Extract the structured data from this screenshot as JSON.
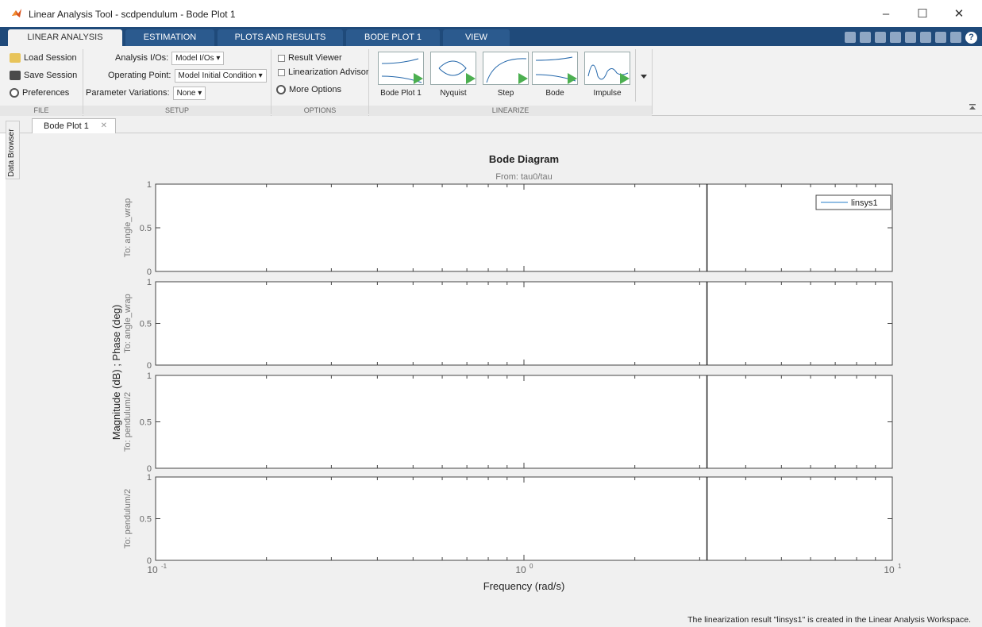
{
  "window": {
    "title": "Linear Analysis Tool - scdpendulum - Bode Plot 1",
    "minimize": "–",
    "maximize": "☐",
    "close": "✕"
  },
  "ribbon": {
    "tabs": [
      "LINEAR ANALYSIS",
      "ESTIMATION",
      "PLOTS AND RESULTS",
      "BODE PLOT 1",
      "VIEW"
    ],
    "help_glyph": "?"
  },
  "toolstrip": {
    "file": {
      "load": "Load Session",
      "save": "Save Session",
      "prefs": "Preferences",
      "label": "FILE"
    },
    "setup": {
      "analysis_ios_label": "Analysis I/Os:",
      "analysis_ios_value": "Model I/Os ▾",
      "operating_point_label": "Operating Point:",
      "operating_point_value": "Model Initial Condition ▾",
      "param_var_label": "Parameter Variations:",
      "param_var_value": "None ▾",
      "label": "SETUP"
    },
    "options": {
      "result_viewer": "Result Viewer",
      "lin_advisor": "Linearization Advisor",
      "more_options": "More Options",
      "label": "OPTIONS"
    },
    "linearize": {
      "buttons": [
        "Bode Plot 1",
        "Nyquist",
        "Step",
        "Bode",
        "Impulse"
      ],
      "label": "LINEARIZE"
    }
  },
  "documents": {
    "tab": "Bode Plot 1",
    "close": "✕",
    "side_panel": "Data Browser"
  },
  "chart_data": {
    "type": "line",
    "title": "Bode Diagram",
    "subtitle": "From: tau0/tau",
    "xlabel": "Frequency  (rad/s)",
    "ylabel": "Magnitude (dB) ; Phase (deg)",
    "xscale": "log",
    "xlim": [
      0.1,
      10
    ],
    "x_ticks": [
      "10",
      "10",
      "10"
    ],
    "x_tick_exponents": [
      "-1",
      "0",
      "1"
    ],
    "subplots": [
      {
        "ylabel": "To: angle_wrap",
        "ylim": [
          0,
          1
        ],
        "yticks": [
          "0",
          "0.5",
          "1"
        ]
      },
      {
        "ylabel": "To: angle_wrap",
        "ylim": [
          0,
          1
        ],
        "yticks": [
          "0",
          "0.5",
          "1"
        ]
      },
      {
        "ylabel": "To: pendulum/2",
        "ylim": [
          0,
          1
        ],
        "yticks": [
          "0",
          "0.5",
          "1"
        ]
      },
      {
        "ylabel": "To: pendulum/2",
        "ylim": [
          0,
          1
        ],
        "yticks": [
          "0",
          "0.5",
          "1"
        ]
      }
    ],
    "vertical_line_x": 3.14,
    "legend": {
      "entries": [
        "linsys1"
      ],
      "placement": "top-right",
      "color": "#6fa8dc"
    },
    "grid": false
  },
  "status": {
    "message": "The linearization result \"linsys1\" is created in the Linear Analysis Workspace."
  }
}
